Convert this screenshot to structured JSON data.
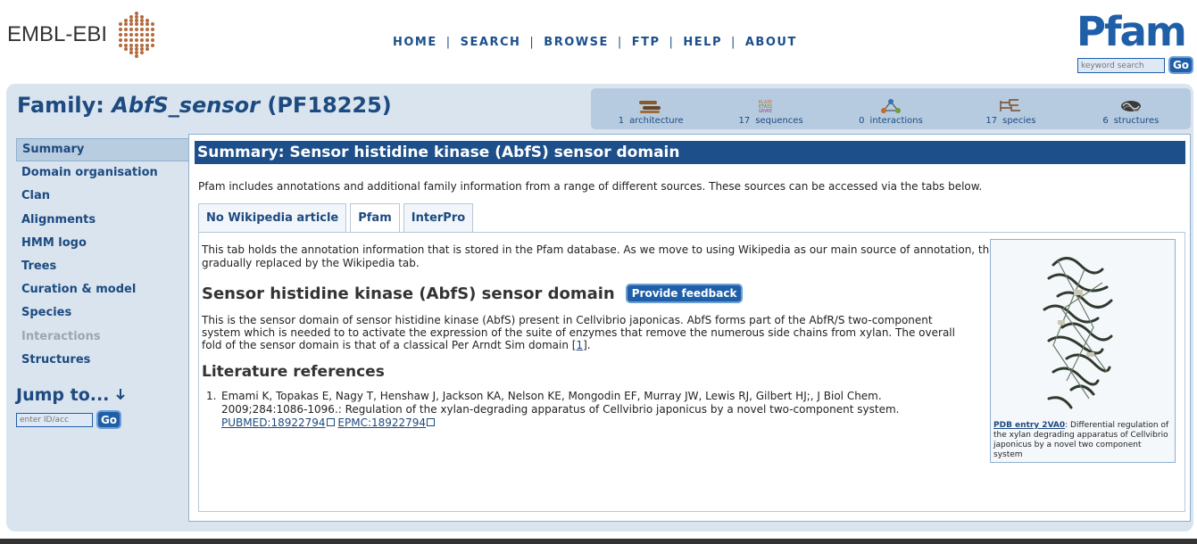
{
  "brand": {
    "ebi": "EMBL-EBI",
    "pfam": "Pfam"
  },
  "topnav": [
    "HOME",
    "SEARCH",
    "BROWSE",
    "FTP",
    "HELP",
    "ABOUT"
  ],
  "search": {
    "placeholder": "keyword search",
    "go": "Go"
  },
  "family": {
    "prefix": "Family:",
    "name": "AbfS_sensor",
    "accession": "(PF18225)"
  },
  "iconbar": [
    {
      "icon": "architecture-icon",
      "count": "1",
      "label": "architecture"
    },
    {
      "icon": "sequences-icon",
      "count": "17",
      "label": "sequences"
    },
    {
      "icon": "interactions-icon",
      "count": "0",
      "label": "interactions"
    },
    {
      "icon": "species-icon",
      "count": "17",
      "label": "species"
    },
    {
      "icon": "structures-icon",
      "count": "6",
      "label": "structures"
    }
  ],
  "sidenav": [
    {
      "label": "Summary",
      "state": "active"
    },
    {
      "label": "Domain organisation",
      "state": "normal"
    },
    {
      "label": "Clan",
      "state": "normal"
    },
    {
      "label": "Alignments",
      "state": "normal"
    },
    {
      "label": "HMM logo",
      "state": "normal"
    },
    {
      "label": "Trees",
      "state": "normal"
    },
    {
      "label": "Curation & model",
      "state": "normal"
    },
    {
      "label": "Species",
      "state": "normal"
    },
    {
      "label": "Interactions",
      "state": "disabled"
    },
    {
      "label": "Structures",
      "state": "normal"
    }
  ],
  "jump": {
    "title": "Jump to...",
    "placeholder": "enter ID/acc",
    "go": "Go"
  },
  "summary": {
    "header": "Summary: Sensor histidine kinase (AbfS) sensor domain",
    "intro": "Pfam includes annotations and additional family information from a range of different sources. These sources can be accessed via the tabs below.",
    "tabs": [
      "No Wikipedia article",
      "Pfam",
      "InterPro"
    ],
    "active_tab": "Pfam",
    "tab_note": "This tab holds the annotation information that is stored in the Pfam database. As we move to using Wikipedia as our main source of annotation, the contents of this tab will be gradually replaced by the Wikipedia tab.",
    "heading": "Sensor histidine kinase (AbfS) sensor domain",
    "feedback": "Provide feedback",
    "description": "This is the sensor domain of sensor histidine kinase (AbfS) present in Cellvibrio japonicas. AbfS forms part of the AbfR/S two-component system which is needed to to activate the expression of the suite of enzymes that remove the numerous side chains from xylan. The overall fold of the sensor domain is that of a classical Per Arndt Sim domain [",
    "ref_link": "1",
    "description_end": "].",
    "lit_heading": "Literature references",
    "references": [
      {
        "num": "1.",
        "text": "Emami K, Topakas E, Nagy T, Henshaw J, Jackson KA, Nelson KE, Mongodin EF, Murray JW, Lewis RJ, Gilbert HJ;, J Biol Chem. 2009;284:1086-1096.: Regulation of the xylan-degrading apparatus of Cellvibrio japonicus by a novel two-component system.",
        "pubmed": "PUBMED:18922794",
        "epmc": "EPMC:18922794"
      }
    ]
  },
  "structure": {
    "link": "PDB entry 2VA0",
    "caption": ": Differential regulation of the xylan degrading apparatus of Cellvibrio japonicus by a novel two component system"
  }
}
